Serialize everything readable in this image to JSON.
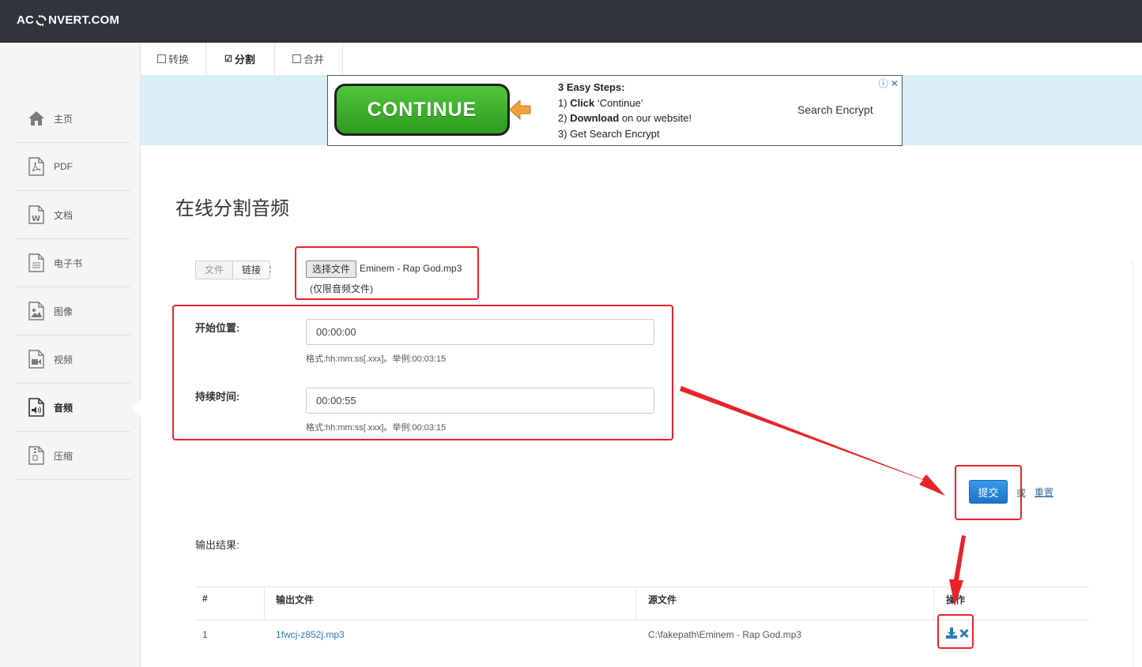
{
  "header": {
    "logo_left": "AC",
    "logo_right": "NVERT.COM"
  },
  "tabs": [
    {
      "label": "转换",
      "checked": false
    },
    {
      "label": "分割",
      "checked": true
    },
    {
      "label": "合并",
      "checked": false
    }
  ],
  "sidebar": {
    "items": [
      {
        "label": "主页",
        "icon": "home-icon"
      },
      {
        "label": "PDF",
        "icon": "pdf-file-icon"
      },
      {
        "label": "文档",
        "icon": "word-file-icon"
      },
      {
        "label": "电子书",
        "icon": "ebook-file-icon"
      },
      {
        "label": "图像",
        "icon": "image-file-icon"
      },
      {
        "label": "视频",
        "icon": "video-file-icon"
      },
      {
        "label": "音频",
        "icon": "audio-file-icon"
      },
      {
        "label": "压缩",
        "icon": "archive-file-icon"
      }
    ],
    "active_index": 6
  },
  "ad": {
    "button_label": "CONTINUE",
    "steps_title": "3 Easy Steps:",
    "step1_num": "1)",
    "step1_bold": "Click",
    "step1_rest": "‘Continue’",
    "step2_num": "2)",
    "step2_bold": "Download",
    "step2_rest": "on our website!",
    "step3": "3) Get Search Encrypt",
    "right_text": "Search Encrypt",
    "close_glyphs": "ⓘ ✕"
  },
  "main": {
    "title": "在线分割音频",
    "source": {
      "file_label": "文件",
      "link_label": "链接",
      "colon": ":"
    },
    "file": {
      "button_label": "选择文件",
      "filename": "Eminem - Rap God.mp3",
      "hint": "(仅限音频文件)"
    },
    "start": {
      "label": "开始位置:",
      "value": "00:00:00",
      "help": "格式:hh:mm:ss[.xxx]。举例:00:03:15"
    },
    "duration": {
      "label": "持续时间:",
      "value": "00:00:55",
      "help": "格式:hh:mm:ss[.xxx]。举例:00:03:15"
    },
    "submit_label": "提交",
    "or_label": "或",
    "reset_label": "重置",
    "output_label": "输出结果:"
  },
  "table": {
    "headers": [
      "#",
      "输出文件",
      "源文件",
      "操作"
    ],
    "rows": [
      {
        "index": "1",
        "output": "1fwcj-z852j.mp3",
        "source": "C:\\fakepath\\Eminem - Rap God.mp3"
      }
    ]
  },
  "colors": {
    "annotation_red": "#e8232a",
    "accent_blue": "#2a7ab9",
    "header_bg": "#2f353b",
    "ad_green": "#3bb12a"
  }
}
